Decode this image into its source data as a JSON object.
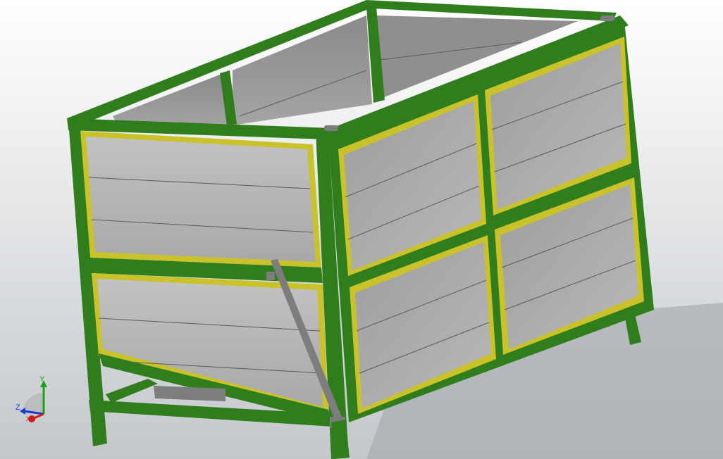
{
  "viewport": {
    "background_top": "#ffffff",
    "background_bottom": "#c4c8cc",
    "shadow_color": "#a6aaaf"
  },
  "model": {
    "frame_color": "#2f7d1c",
    "frame_dark": "#1f5a12",
    "frame_light": "#3c9427",
    "panel_color": "#b4b4b4",
    "panel_dark": "#8c8c8c",
    "panel_border": "#c9c22a",
    "panel_line": "#5a5a5a",
    "strut_color": "#7d7d7d"
  },
  "triad": {
    "y_label": "Y",
    "z_label": "Z",
    "x_label": "X",
    "y_color": "#1aa31a",
    "z_color": "#1a3ad1",
    "x_color": "#d11a1a"
  }
}
